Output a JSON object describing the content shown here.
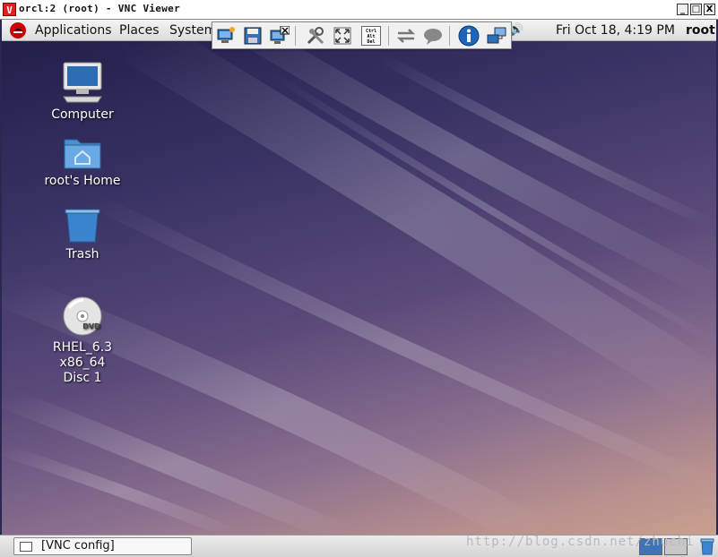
{
  "window": {
    "title": "orcl:2 (root) - VNC Viewer",
    "logo_letter": "V",
    "buttons": [
      "_",
      "□",
      "X"
    ]
  },
  "panel": {
    "menus": [
      "Applications",
      "Places",
      "System"
    ],
    "clock": "Fri Oct 18,  4:19 PM",
    "user": "root"
  },
  "vnc_toolbar": {
    "buttons": [
      "new-connection-icon",
      "save-icon",
      "disconnect-icon",
      "options-icon",
      "fullscreen-icon",
      "ctrl-alt-del-icon",
      "transfer-icon",
      "chat-icon",
      "info-icon",
      "connections-icon"
    ],
    "ctrl_alt_del": [
      "Ctrl",
      "Alt",
      "Del"
    ]
  },
  "desktop_icons": [
    {
      "label": "Computer",
      "icon": "computer-icon"
    },
    {
      "label": "root's Home",
      "icon": "home-folder-icon"
    },
    {
      "label": "Trash",
      "icon": "trash-icon"
    },
    {
      "label": "RHEL_6.3 x86_64\nDisc 1",
      "icon": "dvd-icon",
      "dvd_text": "DVD"
    }
  ],
  "taskbar": {
    "window_button": "[VNC config]"
  },
  "watermark": "http://blog.csdn.net/zhuchi"
}
